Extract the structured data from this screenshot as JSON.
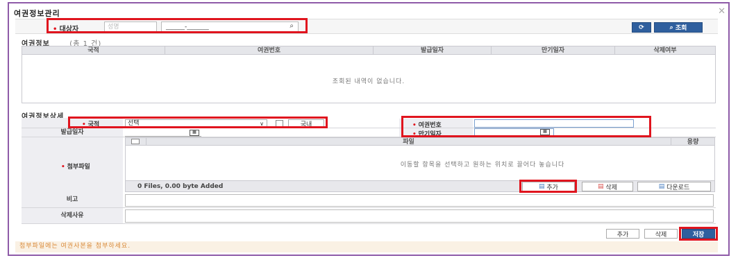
{
  "window": {
    "title": "여권정보관리",
    "close_icon": "close-icon"
  },
  "search": {
    "label": "대상자",
    "placeholder": "성명",
    "id_value": "______-_______",
    "refresh_icon": "refresh-icon",
    "search_button": "조회"
  },
  "passport_list": {
    "section_title": "여권정보",
    "count_text": "(총 1 건)",
    "columns": [
      "국적",
      "여권번호",
      "발급일자",
      "만기일자",
      "삭제여부"
    ],
    "empty_message": "조회된 내역이 없습니다."
  },
  "detail": {
    "section_title": "여권정보상세",
    "nationality_label": "국적",
    "nationality_select": "선택",
    "domestic_label": "국내",
    "passport_no_label": "여권번호",
    "passport_no_value": "",
    "issue_date_label": "발급일자",
    "expiry_date_label": "만기일자",
    "attachment_label": "첨부파일",
    "file_column": "파일",
    "size_column": "용량",
    "drop_message": "이동할 항목을 선택하고 원하는 위치로 끌어다 놓습니다",
    "file_status": "0 Files, 0.00 byte Added",
    "add_file_button": "추가",
    "delete_file_button": "삭제",
    "download_button": "다운로드",
    "remark_label": "비고",
    "delete_reason_label": "삭제사유"
  },
  "footer": {
    "add_button": "추가",
    "delete_button": "삭제",
    "save_button": "저장",
    "notice": "첨부파일에는 여권사본을 첨부하세요."
  },
  "colors": {
    "highlight": "#e0141e",
    "primary": "#2f5f9e",
    "frame": "#8e5aa8",
    "notice_text": "#d98a3a"
  }
}
